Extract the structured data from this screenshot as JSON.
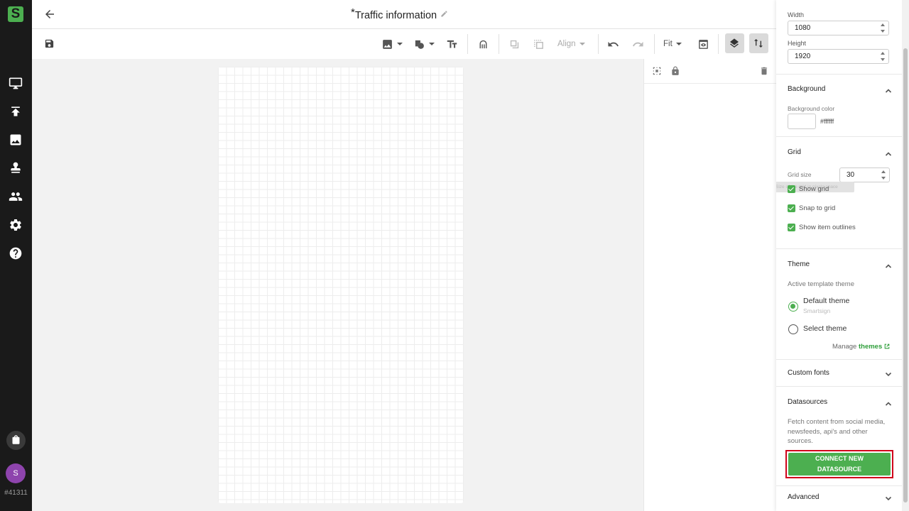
{
  "app": {
    "logo_letter": "S",
    "user_initial": "S",
    "user_id": "#41311",
    "brand_color": "#4caf50"
  },
  "header": {
    "unsaved_marker": "*",
    "title": "Traffic information"
  },
  "toolbar": {
    "align_label": "Align",
    "zoom_label": "Fit"
  },
  "sidebar": {
    "items": [
      {
        "icon": "monitor-icon"
      },
      {
        "icon": "upload-icon"
      },
      {
        "icon": "image-icon"
      },
      {
        "icon": "stamp-icon"
      },
      {
        "icon": "people-icon"
      },
      {
        "icon": "gear-icon"
      },
      {
        "icon": "help-icon"
      }
    ]
  },
  "properties": {
    "width_label": "Width",
    "width_value": "1080",
    "height_label": "Height",
    "height_value": "1920",
    "background": {
      "title": "Background",
      "color_label": "Background color",
      "color_value": "#ffffff"
    },
    "grid": {
      "title": "Grid",
      "size_label": "Grid size",
      "size_value": "30",
      "tooltip": "Size of the grid in pixels space",
      "show_grid": "Show grid",
      "snap_to_grid": "Snap to grid",
      "show_outlines": "Show item outlines"
    },
    "theme": {
      "title": "Theme",
      "active_label": "Active template theme",
      "default_theme": "Default theme",
      "default_theme_sub": "Smartsign",
      "select_theme": "Select theme",
      "manage_prefix": "Manage",
      "manage_link": "themes"
    },
    "custom_fonts": {
      "title": "Custom fonts"
    },
    "datasources": {
      "title": "Datasources",
      "description": "Fetch content from social media, newsfeeds, api's and other sources.",
      "connect_line1": "CONNECT NEW",
      "connect_line2": "DATASOURCE"
    },
    "advanced": {
      "title": "Advanced"
    }
  }
}
